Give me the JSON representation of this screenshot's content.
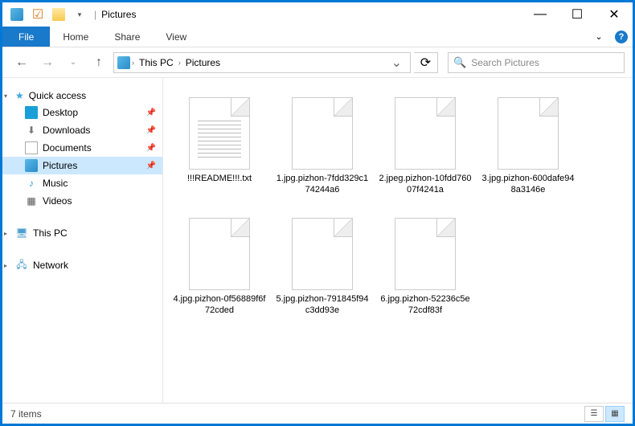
{
  "titlebar": {
    "separator": "|",
    "title": "Pictures",
    "minimize": "—",
    "maximize": "☐",
    "close": "✕"
  },
  "ribbon": {
    "file": "File",
    "home": "Home",
    "share": "Share",
    "view": "View",
    "help": "?",
    "expand": "⌄"
  },
  "nav": {
    "back": "←",
    "forward": "→",
    "recent": "⌄",
    "up": "↑",
    "crumbs": [
      {
        "label": "This PC"
      },
      {
        "label": "Pictures"
      }
    ],
    "crumb_sep": "›",
    "dropdown": "⌄",
    "refresh": "⟳",
    "search_placeholder": "Search Pictures"
  },
  "sidebar": {
    "quick_access": "Quick access",
    "items": [
      {
        "label": "Desktop",
        "icon": "desktop"
      },
      {
        "label": "Downloads",
        "icon": "download"
      },
      {
        "label": "Documents",
        "icon": "document"
      },
      {
        "label": "Pictures",
        "icon": "pictures",
        "selected": true
      },
      {
        "label": "Music",
        "icon": "music"
      },
      {
        "label": "Videos",
        "icon": "video"
      }
    ],
    "this_pc": "This PC",
    "network": "Network"
  },
  "files": [
    {
      "name": "!!!README!!!.txt",
      "type": "text"
    },
    {
      "name": "1.jpg.pizhon-7fdd329c174244a6",
      "type": "blank"
    },
    {
      "name": "2.jpeg.pizhon-10fdd76007f4241a",
      "type": "blank"
    },
    {
      "name": "3.jpg.pizhon-600dafe948a3146e",
      "type": "blank"
    },
    {
      "name": "4.jpg.pizhon-0f56889f6f72cded",
      "type": "blank"
    },
    {
      "name": "5.jpg.pizhon-791845f94c3dd93e",
      "type": "blank"
    },
    {
      "name": "6.jpg.pizhon-52236c5e72cdf83f",
      "type": "blank"
    }
  ],
  "statusbar": {
    "count": "7 items"
  }
}
